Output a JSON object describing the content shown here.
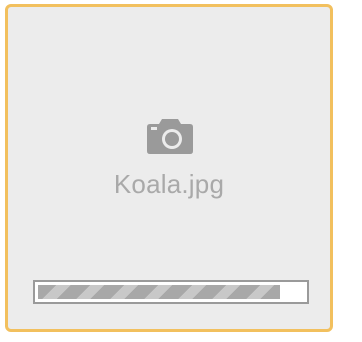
{
  "upload": {
    "file_name": "Koala.jpg",
    "file_icon": "camera-icon",
    "progress_fraction": 0.91,
    "colors": {
      "border": "#f2c05e",
      "card_background": "#ececec",
      "text": "#a9a9a9",
      "bar_track": "#ffffff",
      "bar_fill": "#a8a8a8"
    }
  }
}
